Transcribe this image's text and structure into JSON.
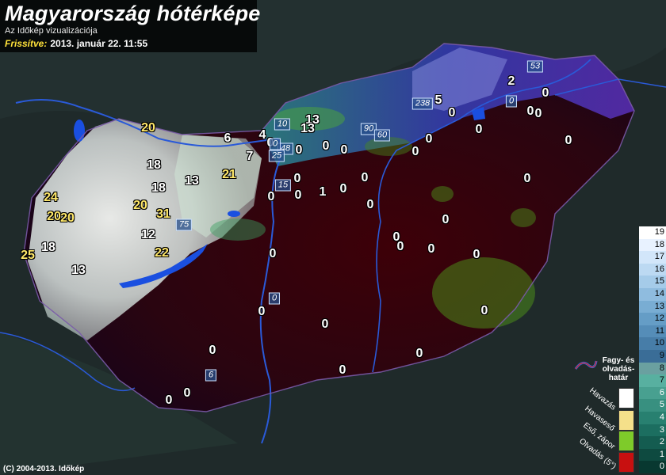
{
  "header": {
    "title": "Magyarország hótérképe",
    "subtitle": "Az Időkép vizualizációja",
    "updated_label": "Frissítve:",
    "updated_value": "2013. január 22. 11:55"
  },
  "footer": {
    "copyright": "(C) 2004-2013. Időkép"
  },
  "map_values": [
    "20",
    "6",
    "4",
    "13",
    "13",
    "5",
    "2",
    "0",
    "0",
    "0",
    "0",
    "0",
    "18",
    "7",
    "21",
    "13",
    "0",
    "0",
    "0",
    "0",
    "0",
    "18",
    "0",
    "1",
    "0",
    "0",
    "0",
    "0",
    "0",
    "24",
    "20",
    "20",
    "20",
    "31",
    "0",
    "0",
    "0",
    "18",
    "12",
    "0",
    "0",
    "0",
    "0",
    "25",
    "22",
    "13",
    "0",
    "0",
    "0",
    "0",
    "0",
    "0",
    "0",
    "0",
    "0",
    "0"
  ],
  "peak_labels": [
    "53",
    "0",
    "238",
    "10",
    "48",
    "25",
    "90",
    "60",
    "15",
    "75",
    "0",
    "6",
    "0"
  ],
  "scale": {
    "ticks": [
      "19",
      "18",
      "17",
      "16",
      "15",
      "14",
      "13",
      "12",
      "11",
      "10",
      "9",
      "8",
      "7",
      "6",
      "5",
      "4",
      "3",
      "2",
      "1",
      "0"
    ],
    "colors": [
      "#ffffff",
      "#e8f2ff",
      "#d2e6fa",
      "#bcd9f2",
      "#a5cbe9",
      "#8fbcdf",
      "#79add3",
      "#659dc6",
      "#558db8",
      "#477da8",
      "#3a6d97",
      "#6aa0a0",
      "#58b0a0",
      "#48a090",
      "#389080",
      "#288070",
      "#1c6e60",
      "#145c50",
      "#0e4a40",
      "#083830"
    ]
  },
  "legend": {
    "frost_label": "Fagy- és olvadás-határ",
    "categories": [
      "Havazás",
      "Havaseső",
      "Eső, zápor",
      "Olvadás (5°)"
    ],
    "colors": [
      "#ffffff",
      "#f5e08a",
      "#7ecb2a",
      "#c81010"
    ]
  }
}
